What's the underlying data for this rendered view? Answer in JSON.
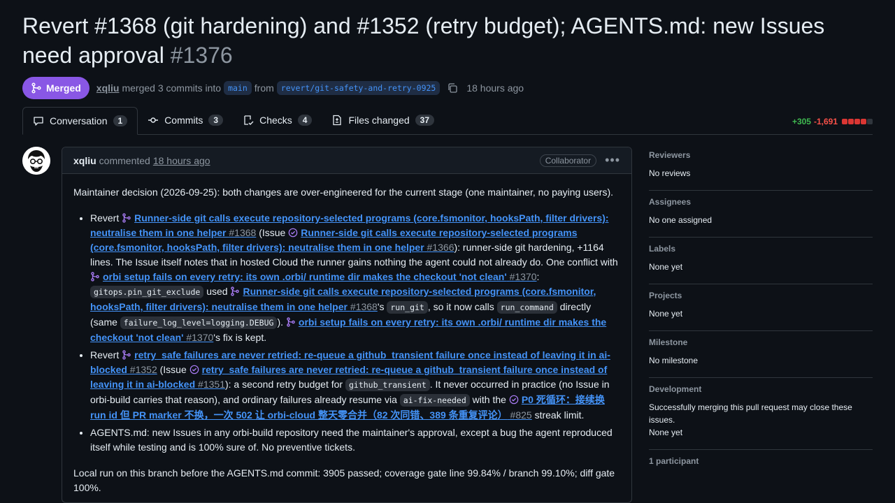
{
  "pr": {
    "title": "Revert #1368 (git hardening) and #1352 (retry budget); AGENTS.md: new Issues need approval",
    "number": "#1376",
    "state": "Merged",
    "author": "xqliu",
    "merged_text": "merged 3 commits into",
    "base_branch": "main",
    "from_text": "from",
    "head_branch": "revert/git-safety-and-retry-0925",
    "time_ago": "18 hours ago"
  },
  "tabs": [
    {
      "label": "Conversation",
      "count": "1"
    },
    {
      "label": "Commits",
      "count": "3"
    },
    {
      "label": "Checks",
      "count": "4"
    },
    {
      "label": "Files changed",
      "count": "37"
    }
  ],
  "diffstat": {
    "additions": "+305",
    "deletions": "-1,691"
  },
  "comment": {
    "author": "xqliu",
    "action": "commented",
    "time": "18 hours ago",
    "role": "Collaborator",
    "intro": "Maintainer decision (2026-09-25): both changes are over-engineered for the current stage (one maintainer, no paying users).",
    "b1": {
      "t1": "Revert ",
      "pr1368_title": "Runner-side git calls execute repository-selected programs (core.fsmonitor, hooksPath, filter drivers): neutralise them in one helper",
      "pr1368_num": "#1368",
      "t2": " (Issue ",
      "iss1366_title": "Runner-side git calls execute repository-selected programs (core.fsmonitor, hooksPath, filter drivers): neutralise them in one helper",
      "iss1366_num": "#1366",
      "t3": "): runner-side git hardening, +1164 lines. The Issue itself notes that in hosted Cloud the runner gains nothing the agent could not already do. One conflict with ",
      "pr1370_title": "orbi setup fails on every retry: its own .orbi/ runtime dir makes the checkout 'not clean'",
      "pr1370_num": "#1370",
      "t4": ": ",
      "code1": "gitops.pin_git_exclude",
      "t5": " used ",
      "pr1368b_title": "Runner-side git calls execute repository-selected programs (core.fsmonitor, hooksPath, filter drivers): neutralise them in one helper",
      "pr1368b_num": "#1368",
      "t6": "'s ",
      "code2": "run_git",
      "t7": ", so it now calls ",
      "code3": "run_command",
      "t8": " directly (same ",
      "code4": "failure_log_level=logging.DEBUG",
      "t9": "). ",
      "pr1370b_title": "orbi setup fails on every retry: its own .orbi/ runtime dir makes the checkout 'not clean'",
      "pr1370b_num": "#1370",
      "t10": "'s fix is kept."
    },
    "b2": {
      "t1": "Revert ",
      "pr1352_title": "retry_safe failures are never retried: re-queue a github_transient failure once instead of leaving it in ai-blocked",
      "pr1352_num": "#1352",
      "t2": " (Issue ",
      "iss1351_title": "retry_safe failures are never retried: re-queue a github_transient failure once instead of leaving it in ai-blocked",
      "iss1351_num": "#1351",
      "t3": "): a second retry budget for ",
      "code1": "github_transient",
      "t4": ". It never occurred in practice (no Issue in orbi-build carries that reason), and ordinary failures already resume via ",
      "code2": "ai-fix-needed",
      "t5": " with the ",
      "iss825_title": "P0 死循环：接续换 run id 但 PR marker 不换，一次 502 让 orbi-cloud 整天零合并（82 次同错、389 条重复评论）",
      "iss825_num": "#825",
      "t6": " streak limit."
    },
    "b3": "AGENTS.md: new Issues in any orbi-build repository need the maintainer's approval, except a bug the agent reproduced itself while testing and is 100% sure of. No preventive tickets.",
    "outro": "Local run on this branch before the AGENTS.md commit: 3905 passed; coverage gate line 99.84% / branch 99.10%; diff gate 100%."
  },
  "sidebar": {
    "reviewers": {
      "label": "Reviewers",
      "value": "No reviews"
    },
    "assignees": {
      "label": "Assignees",
      "value": "No one assigned"
    },
    "labels": {
      "label": "Labels",
      "value": "None yet"
    },
    "projects": {
      "label": "Projects",
      "value": "None yet"
    },
    "milestone": {
      "label": "Milestone",
      "value": "No milestone"
    },
    "development": {
      "label": "Development",
      "note": "Successfully merging this pull request may close these issues.",
      "value": "None yet"
    },
    "participants": {
      "label": "1 participant"
    }
  },
  "colors": {
    "merged": "#8957e5",
    "link": "#4493f8",
    "added": "#3fb950",
    "deleted": "#f85149"
  }
}
